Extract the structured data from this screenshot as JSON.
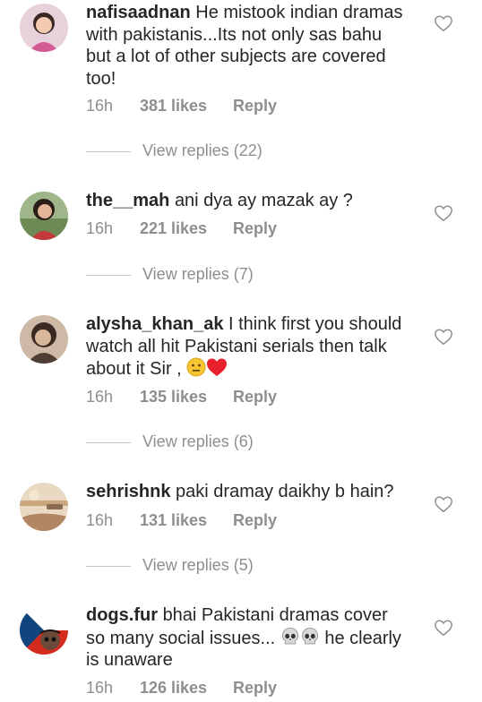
{
  "comments": [
    {
      "username": "nafisaadnan",
      "text": "He mistook indian dramas with pakistanis...Its not only sas bahu but a lot of other subjects are covered too!",
      "time": "16h",
      "likes": "381 likes",
      "reply": "Reply",
      "view_replies": "View replies (22)",
      "avatar_icon": "avatar-girl-pink",
      "like_icon": "heart-outline-icon"
    },
    {
      "username": "the__mah",
      "text": "ani dya ay mazak ay ?",
      "time": "16h",
      "likes": "221 likes",
      "reply": "Reply",
      "view_replies": "View replies (7)",
      "avatar_icon": "avatar-woman-outdoor",
      "like_icon": "heart-outline-icon"
    },
    {
      "username": "alysha_khan_ak",
      "text": "I think first you should watch all hit Pakistani serials then talk about it Sir ,",
      "text_emojis": [
        "neutral-face-emoji",
        "red-heart-emoji"
      ],
      "time": "16h",
      "likes": "135 likes",
      "reply": "Reply",
      "view_replies": "View replies (6)",
      "avatar_icon": "avatar-woman-sepia",
      "like_icon": "heart-outline-icon"
    },
    {
      "username": "sehrishnk",
      "text": "paki dramay daikhy b hain?",
      "time": "16h",
      "likes": "131 likes",
      "reply": "Reply",
      "view_replies": "View replies (5)",
      "avatar_icon": "avatar-landscape",
      "like_icon": "heart-outline-icon"
    },
    {
      "username": "dogs.fur",
      "text": "bhai Pakistani dramas cover so many social issues...",
      "text_emojis": [
        "skull-emoji",
        "skull-emoji"
      ],
      "text_after": "he clearly is unaware",
      "time": "16h",
      "likes": "126 likes",
      "reply": "Reply",
      "avatar_icon": "avatar-dog-flag",
      "like_icon": "heart-outline-icon"
    }
  ],
  "colors": {
    "text": "#262626",
    "muted": "#8e8e8e",
    "divider": "#c7c7c7",
    "background": "#ffffff"
  }
}
